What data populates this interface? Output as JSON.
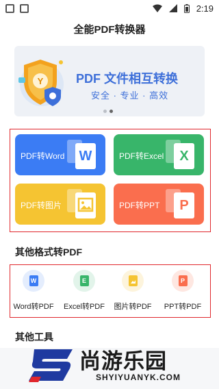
{
  "status_bar": {
    "time": "2:19"
  },
  "header": {
    "title": "全能PDF转换器"
  },
  "banner": {
    "heading": "PDF 文件相互转换",
    "subtitle": "安全 · 专业 · 高效",
    "shield_badge": "Y",
    "pages": 2,
    "active_page": 2
  },
  "tiles": [
    {
      "label": "PDF转Word",
      "glyph": "W",
      "color": "#3b7cf4"
    },
    {
      "label": "PDF转Excel",
      "glyph": "X",
      "color": "#38b56a"
    },
    {
      "label": "PDF转图片",
      "glyph": "",
      "color": "#f5c432"
    },
    {
      "label": "PDF转PPT",
      "glyph": "P",
      "color": "#fa6e4e"
    }
  ],
  "sections": {
    "other_formats": "其他格式转PDF",
    "other_tools": "其他工具"
  },
  "tools": [
    {
      "label": "Word转PDF",
      "glyph": "W",
      "color": "#3b7cf4"
    },
    {
      "label": "Excel转PDF",
      "glyph": "E",
      "color": "#38b56a"
    },
    {
      "label": "图片转PDF",
      "glyph": "",
      "color": "#f5c432"
    },
    {
      "label": "PPT转PDF",
      "glyph": "P",
      "color": "#fa6e4e"
    }
  ],
  "watermark": {
    "text": "尚游乐园",
    "url": "SHYIYUANYK.COM"
  }
}
